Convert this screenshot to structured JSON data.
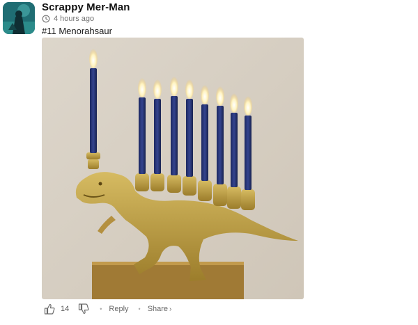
{
  "post": {
    "author": "Scrappy Mer-Man",
    "time": "4 hours ago",
    "title": "#11 Menorahsaur"
  },
  "icons": {
    "avatar": "avatar-image",
    "time": "clock-icon",
    "upvote": "thumbs-up-icon",
    "downvote": "thumbs-down-icon",
    "share": "chevron-right-icon"
  },
  "actions": {
    "likes": "14",
    "reply": "Reply",
    "share": "Share",
    "share_chevron": "›",
    "separator": "•"
  },
  "colors": {
    "candle": "#22306e",
    "gold": "#b4963a",
    "wall": "#d9d2c6",
    "avatar": "#1f6d73"
  }
}
